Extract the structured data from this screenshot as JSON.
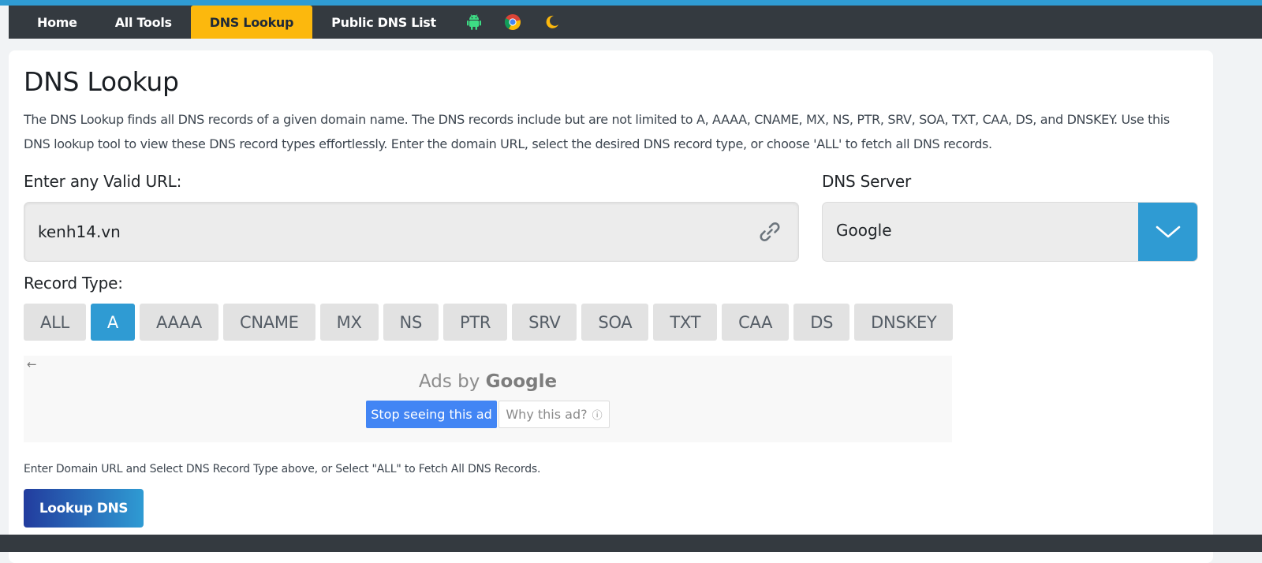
{
  "nav": {
    "items": [
      {
        "label": "Home",
        "active": false
      },
      {
        "label": "All Tools",
        "active": false
      },
      {
        "label": "DNS Lookup",
        "active": true
      },
      {
        "label": "Public DNS List",
        "active": false
      }
    ],
    "icons": [
      "android-icon",
      "chrome-icon",
      "moon-icon"
    ],
    "active_color": "#fcb80d",
    "bar_color": "#343a40"
  },
  "page": {
    "title": "DNS Lookup",
    "description": "The DNS Lookup finds all DNS records of a given domain name. The DNS records include but are not limited to A, AAAA, CNAME, MX, NS, PTR, SRV, SOA, TXT, CAA, DS, and DNSKEY. Use this DNS lookup tool to view these DNS record types effortlessly. Enter the domain URL, select the desired DNS record type, or choose 'ALL' to fetch all DNS records."
  },
  "url_field": {
    "label": "Enter any Valid URL:",
    "value": "kenh14.vn",
    "icon": "link-icon"
  },
  "dns_server": {
    "label": "DNS Server",
    "selected": "Google",
    "icon": "chevron-down-icon",
    "accent": "#2f9bd3"
  },
  "record_type": {
    "label": "Record Type:",
    "options": [
      {
        "label": "ALL",
        "active": false
      },
      {
        "label": "A",
        "active": true
      },
      {
        "label": "AAAA",
        "active": false
      },
      {
        "label": "CNAME",
        "active": false
      },
      {
        "label": "MX",
        "active": false
      },
      {
        "label": "NS",
        "active": false
      },
      {
        "label": "PTR",
        "active": false
      },
      {
        "label": "SRV",
        "active": false
      },
      {
        "label": "SOA",
        "active": false
      },
      {
        "label": "TXT",
        "active": false
      },
      {
        "label": "CAA",
        "active": false
      },
      {
        "label": "DS",
        "active": false
      },
      {
        "label": "DNSKEY",
        "active": false
      }
    ]
  },
  "ad": {
    "back": "←",
    "ads_by": "Ads by",
    "google": "Google",
    "stop_label": "Stop seeing this ad",
    "why_label": "Why this ad?",
    "why_icon": "ⓘ"
  },
  "hint": "Enter Domain URL and Select DNS Record Type above, or Select \"ALL\" to Fetch All DNS Records.",
  "lookup_button": "Lookup DNS"
}
